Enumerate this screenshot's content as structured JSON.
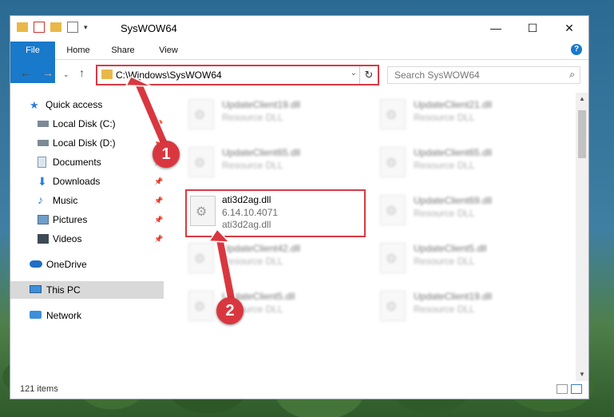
{
  "window": {
    "title": "SysWOW64",
    "minimize": "—",
    "maximize": "☐",
    "close": "✕"
  },
  "ribbon": {
    "tabs": [
      "File",
      "Home",
      "Share",
      "View"
    ],
    "help": "?"
  },
  "address": {
    "path": "C:\\Windows\\SysWOW64",
    "dropdown": "⌄",
    "refresh": "↻"
  },
  "search": {
    "placeholder": "Search SysWOW64"
  },
  "sidebar": {
    "items": [
      {
        "label": "Quick access",
        "icon": "star-icon"
      },
      {
        "label": "Local Disk (C:)",
        "icon": "drive-icon"
      },
      {
        "label": "Local Disk (D:)",
        "icon": "drive-icon"
      },
      {
        "label": "Documents",
        "icon": "documents-icon"
      },
      {
        "label": "Downloads",
        "icon": "downloads-icon"
      },
      {
        "label": "Music",
        "icon": "music-icon"
      },
      {
        "label": "Pictures",
        "icon": "pictures-icon"
      },
      {
        "label": "Videos",
        "icon": "videos-icon"
      },
      {
        "label": "OneDrive",
        "icon": "cloud-icon"
      },
      {
        "label": "This PC",
        "icon": "computer-icon"
      },
      {
        "label": "Network",
        "icon": "network-icon"
      }
    ]
  },
  "files": [
    {
      "name": "UpdateClient19.dll",
      "type": "Resource DLL"
    },
    {
      "name": "UpdateClient21.dll",
      "type": "Resource DLL"
    },
    {
      "name": "UpdateClient65.dll",
      "type": "Resource DLL"
    },
    {
      "name": "UpdateClient65.dll",
      "type": "Resource DLL"
    },
    {
      "name": "ati3d2ag.dll",
      "version": "6.14.10.4071",
      "desc": "ati3d2ag.dll"
    },
    {
      "name": "UpdateClient69.dll",
      "type": "Resource DLL"
    },
    {
      "name": "UpdateClient42.dll",
      "type": "Resource DLL"
    },
    {
      "name": "UpdateClient5.dll",
      "type": "Resource DLL"
    },
    {
      "name": "UpdateClient5.dll",
      "type": "Resource DLL"
    },
    {
      "name": "UpdateClient19.dll",
      "type": "Resource DLL"
    }
  ],
  "status": {
    "items_count": "121 items"
  },
  "annotations": {
    "badge1": "1",
    "badge2": "2",
    "color": "#d9373f"
  }
}
